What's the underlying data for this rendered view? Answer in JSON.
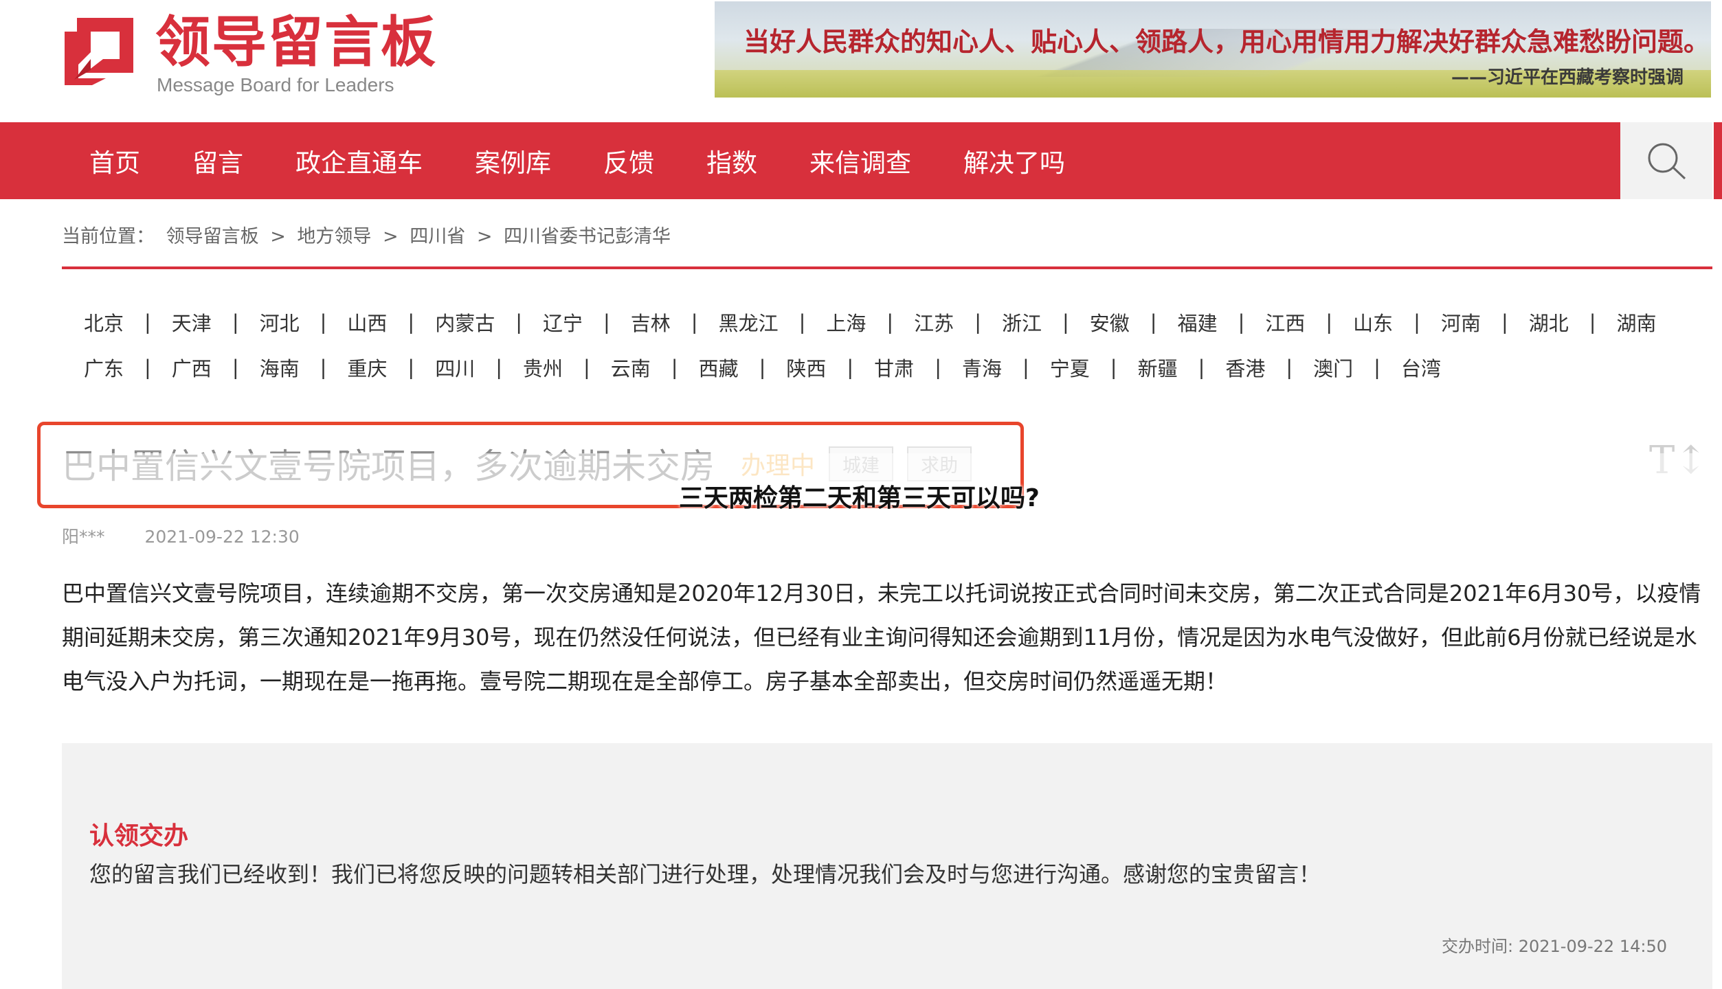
{
  "header": {
    "logo_title": "领导留言板",
    "logo_subtitle": "Message Board for Leaders",
    "banner_quote": "当好人民群众的知心人、贴心人、领路人，用心用情用力解决好群众急难愁盼问题。",
    "banner_author": "——习近平在西藏考察时强调",
    "brand_color": "#d8303c"
  },
  "nav": {
    "items": [
      "首页",
      "留言",
      "政企直通车",
      "案例库",
      "反馈",
      "指数",
      "来信调查",
      "解决了吗"
    ],
    "search_icon": "search-icon"
  },
  "breadcrumb": {
    "prefix": "当前位置：",
    "items": [
      "领导留言板",
      "地方领导",
      "四川省",
      "四川省委书记彭清华"
    ],
    "separator": ">"
  },
  "regions": {
    "row1": [
      "北京",
      "天津",
      "河北",
      "山西",
      "内蒙古",
      "辽宁",
      "吉林",
      "黑龙江",
      "上海",
      "江苏",
      "浙江",
      "安徽",
      "福建",
      "江西",
      "山东",
      "河南",
      "湖北",
      "湖南"
    ],
    "row2": [
      "广东",
      "广西",
      "海南",
      "重庆",
      "四川",
      "贵州",
      "云南",
      "西藏",
      "陕西",
      "甘肃",
      "青海",
      "宁夏",
      "新疆",
      "香港",
      "澳门",
      "台湾"
    ],
    "separator": "|"
  },
  "message": {
    "title": "巴中置信兴文壹号院项目，多次逾期未交房",
    "status": "办理中",
    "tags": [
      "城建",
      "求助"
    ],
    "author": "阳***",
    "date": "2021-09-22 12:30",
    "body": "巴中置信兴文壹号院项目，连续逾期不交房，第一次交房通知是2020年12月30日，未完工以托词说按正式合同时间未交房，第二次正式合同是2021年6月30号，以疫情期间延期未交房，第三次通知2021年9月30号，现在仍然没任何说法，但已经有业主询问得知还会逾期到11月份，情况是因为水电气没做好，但此前6月份就已经说是水电气没入户为托词，一期现在是一拖再拖。壹号院二期现在是全部停工。房子基本全部卖出，但交房时间仍然遥遥无期！",
    "font_size_icon": "text-size-icon"
  },
  "overlay": {
    "question": "三天两检第二天和第三天可以吗?",
    "highlight_color": "#e8452c"
  },
  "reply": {
    "title": "认领交办",
    "body": "您的留言我们已经收到！我们已将您反映的问题转相关部门进行处理，处理情况我们会及时与您进行沟通。感谢您的宝贵留言！",
    "time": "交办时间: 2021-09-22 14:50"
  }
}
